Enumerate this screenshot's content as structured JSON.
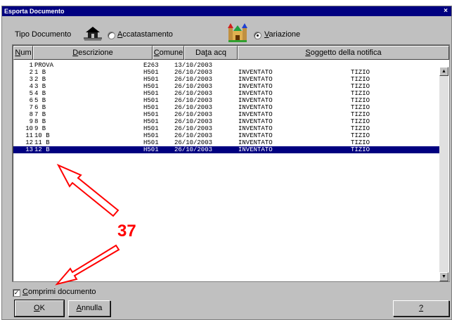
{
  "window": {
    "title": "Esporta Documento",
    "close_glyph": "×"
  },
  "tipo": {
    "label": "Tipo Documento",
    "option1": "Accatastamento",
    "option1_accel": "A",
    "option2": "Variazione",
    "option2_accel": "V",
    "selected": "Variazione"
  },
  "table": {
    "headers": [
      "Num",
      "Descrizione",
      "Comune",
      "Data acq",
      "Soggetto della notifica"
    ],
    "rows": [
      {
        "num": "1",
        "desc": "PROVA",
        "comune": "E263",
        "data": "13/10/2003",
        "sogg": "",
        "nome": ""
      },
      {
        "num": "2",
        "desc": "1 B",
        "comune": "H501",
        "data": "26/10/2003",
        "sogg": "INVENTATO",
        "nome": "TIZIO"
      },
      {
        "num": "3",
        "desc": "2 B",
        "comune": "H501",
        "data": "26/10/2003",
        "sogg": "INVENTATO",
        "nome": "TIZIO"
      },
      {
        "num": "4",
        "desc": "3 B",
        "comune": "H501",
        "data": "26/10/2003",
        "sogg": "INVENTATO",
        "nome": "TIZIO"
      },
      {
        "num": "5",
        "desc": "4 B",
        "comune": "H501",
        "data": "26/10/2003",
        "sogg": "INVENTATO",
        "nome": "TIZIO"
      },
      {
        "num": "6",
        "desc": "5 B",
        "comune": "H501",
        "data": "26/10/2003",
        "sogg": "INVENTATO",
        "nome": "TIZIO"
      },
      {
        "num": "7",
        "desc": "6 B",
        "comune": "H501",
        "data": "26/10/2003",
        "sogg": "INVENTATO",
        "nome": "TIZIO"
      },
      {
        "num": "8",
        "desc": "7 B",
        "comune": "H501",
        "data": "26/10/2003",
        "sogg": "INVENTATO",
        "nome": "TIZIO"
      },
      {
        "num": "9",
        "desc": "8 B",
        "comune": "H501",
        "data": "26/10/2003",
        "sogg": "INVENTATO",
        "nome": "TIZIO"
      },
      {
        "num": "10",
        "desc": "9 B",
        "comune": "H501",
        "data": "26/10/2003",
        "sogg": "INVENTATO",
        "nome": "TIZIO"
      },
      {
        "num": "11",
        "desc": "10 B",
        "comune": "H501",
        "data": "26/10/2003",
        "sogg": "INVENTATO",
        "nome": "TIZIO"
      },
      {
        "num": "12",
        "desc": "11 B",
        "comune": "H501",
        "data": "26/10/2003",
        "sogg": "INVENTATO",
        "nome": "TIZIO"
      },
      {
        "num": "13",
        "desc": "12 B",
        "comune": "H501",
        "data": "26/10/2003",
        "sogg": "INVENTATO",
        "nome": "TIZIO"
      }
    ],
    "selected_row": 13
  },
  "options": {
    "comprimi_label": "Comprimi documento",
    "comprimi_checked": true
  },
  "buttons": {
    "ok": "OK",
    "annulla": "Annulla",
    "help": "?"
  },
  "annotation": {
    "number": "37",
    "color": "#ff0000"
  },
  "icons": {
    "accatastamento": "house-icon",
    "variazione": "castle-icon"
  }
}
